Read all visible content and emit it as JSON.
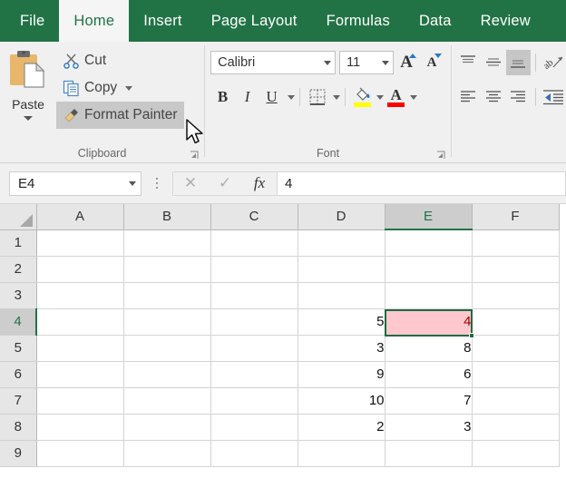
{
  "ribbon": {
    "tabs": [
      {
        "label": "File",
        "active": false
      },
      {
        "label": "Home",
        "active": true
      },
      {
        "label": "Insert",
        "active": false
      },
      {
        "label": "Page Layout",
        "active": false
      },
      {
        "label": "Formulas",
        "active": false
      },
      {
        "label": "Data",
        "active": false
      },
      {
        "label": "Review",
        "active": false
      }
    ],
    "clipboard": {
      "group_label": "Clipboard",
      "paste_label": "Paste",
      "cut_label": "Cut",
      "copy_label": "Copy",
      "format_painter_label": "Format Painter",
      "format_painter_hovered": true
    },
    "font": {
      "group_label": "Font",
      "font_name": "Calibri",
      "font_size": "11",
      "bold_label": "B",
      "italic_label": "I",
      "underline_label": "U",
      "fill_color": "#ffff00",
      "font_color": "#ff0000",
      "font_color_label": "A"
    },
    "alignment": {
      "bottom_align_selected": true
    }
  },
  "formula_bar": {
    "name_box_value": "E4",
    "cancel_label": "✕",
    "enter_label": "✓",
    "function_label": "fx",
    "formula_value": "4"
  },
  "grid": {
    "columns": [
      "A",
      "B",
      "C",
      "D",
      "E",
      "F"
    ],
    "active_column": "E",
    "rows": [
      "1",
      "2",
      "3",
      "4",
      "5",
      "6",
      "7",
      "8",
      "9"
    ],
    "active_row": "4",
    "active_cell": "E4",
    "cells": {
      "D4": "5",
      "E4": "4",
      "D5": "3",
      "E5": "8",
      "D6": "9",
      "E6": "6",
      "D7": "10",
      "E7": "7",
      "D8": "2",
      "E8": "3"
    },
    "highlighted_cell": {
      "ref": "E4",
      "fill": "#ffc7ce",
      "text_color": "#9c0006"
    }
  },
  "colors": {
    "ribbon_green": "#217346",
    "selection_green": "#1e6b42"
  }
}
